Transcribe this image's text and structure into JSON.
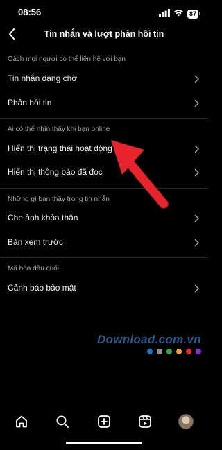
{
  "status_bar": {
    "time": "08:56",
    "battery": "87"
  },
  "nav": {
    "title": "Tin nhắn và lượt phản hồi tin"
  },
  "sections": [
    {
      "header": "Cách mọi người có thể liên hệ với bạn",
      "items": [
        {
          "label": "Tin nhắn đang chờ"
        },
        {
          "label": "Phản hồi tin"
        }
      ]
    },
    {
      "header": "Ai có thể nhìn thấy khi bạn online",
      "items": [
        {
          "label": "Hiển thị trạng thái hoạt động"
        },
        {
          "label": "Hiển thị thông báo đã đọc"
        }
      ]
    },
    {
      "header": "Những gì bạn thấy trong tin nhắn",
      "items": [
        {
          "label": "Che ảnh khỏa thân"
        },
        {
          "label": "Bản xem trước"
        }
      ]
    },
    {
      "header": "Mã hóa đầu cuối",
      "items": [
        {
          "label": "Cảnh báo bảo mật"
        }
      ]
    }
  ],
  "watermark": {
    "text": "Download.com.vn"
  },
  "colors": {
    "annotation_arrow": "#e8232b",
    "watermark_dots": [
      "#1e73be",
      "#8e8e8e",
      "#2ea84a",
      "#e8a317",
      "#e8232b",
      "#8a2be2"
    ]
  },
  "tab_bar": [
    "home-icon",
    "search-icon",
    "create-icon",
    "reels-icon",
    "profile-avatar"
  ]
}
